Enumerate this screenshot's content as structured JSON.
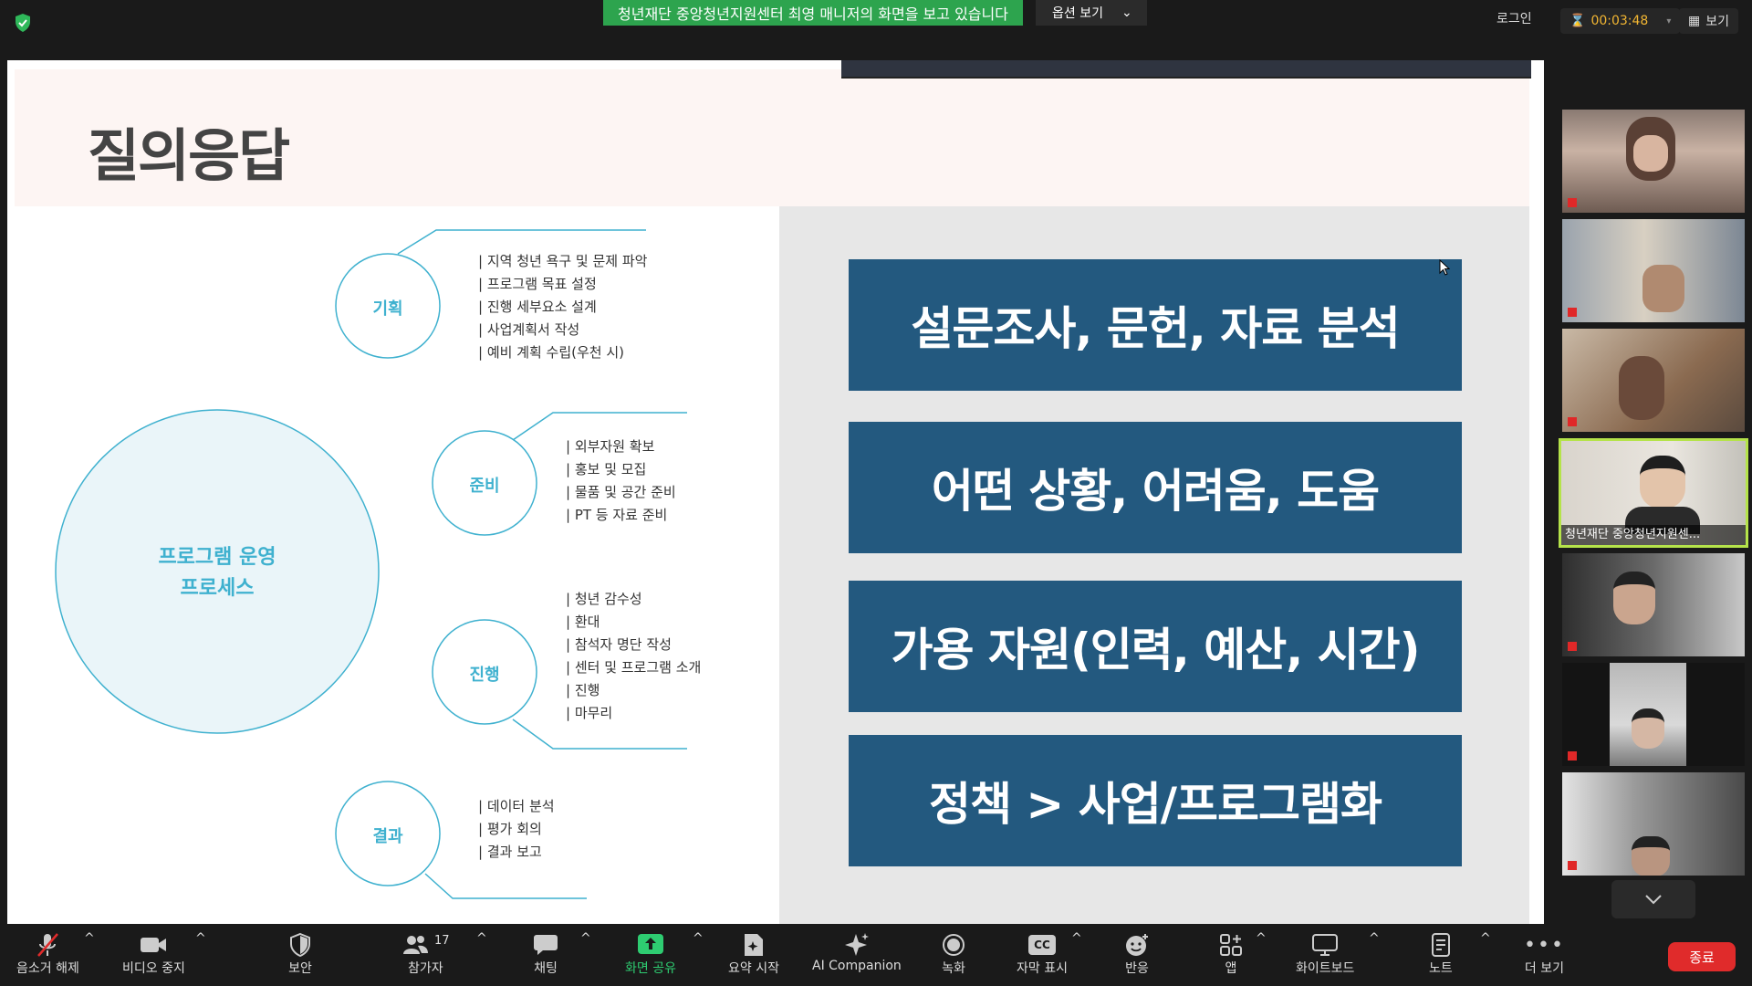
{
  "top": {
    "share_banner": "청년재단 중앙청년지원센터 최영 매니저의 화면을 보고 있습니다",
    "view_options": "옵션 보기",
    "login": "로그인",
    "timer": "00:03:48",
    "view": "보기"
  },
  "slide": {
    "title": "질의응답",
    "center_label_1": "프로그램 운영",
    "center_label_2": "프로세스",
    "stages": [
      {
        "label": "기획",
        "items": [
          "| 지역 청년 욕구 및 문제 파악",
          "| 프로그램 목표 설정",
          "| 진행 세부요소 설계",
          "| 사업계획서 작성",
          "| 예비 계획 수립(우천 시)"
        ]
      },
      {
        "label": "준비",
        "items": [
          "| 외부자원 확보",
          "| 홍보 및 모집",
          "| 물품 및 공간 준비",
          "| PT 등 자료 준비"
        ]
      },
      {
        "label": "진행",
        "items": [
          "| 청년 감수성",
          "| 환대",
          "| 참석자 명단 작성",
          "| 센터 및 프로그램 소개",
          "| 진행",
          "| 마무리"
        ]
      },
      {
        "label": "결과",
        "items": [
          "| 데이터 분석",
          "| 평가 회의",
          "| 결과 보고"
        ]
      }
    ],
    "boxes": [
      "설문조사, 문헌, 자료 분석",
      "어떤 상황, 어려움, 도움",
      "가용 자원(인력, 예산, 시간)",
      "정책 > 사업/프로그램화"
    ]
  },
  "participants": {
    "active_name": "청년재단 중앙청년지원센..."
  },
  "toolbar": {
    "mute": "음소거 해제",
    "video": "비디오 중지",
    "security": "보안",
    "participants": "참가자",
    "participants_count": "17",
    "chat": "채팅",
    "share": "화면 공유",
    "summary": "요약 시작",
    "ai": "AI Companion",
    "record": "녹화",
    "captions": "자막 표시",
    "captions_icon": "CC",
    "reactions": "반응",
    "apps": "앱",
    "whiteboard": "화이트보드",
    "notes": "노트",
    "more": "더 보기",
    "end": "종료"
  },
  "colors": {
    "accent_green": "#2da44e",
    "box_blue": "#23597f",
    "circle_cyan": "#3fb1cf",
    "end_red": "#e02b2b"
  }
}
